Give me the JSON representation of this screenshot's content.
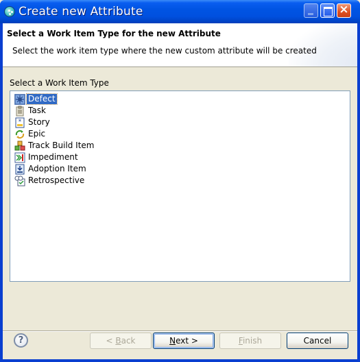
{
  "window": {
    "title": "Create new Attribute",
    "controls": {
      "minimize": "minimize",
      "maximize": "maximize",
      "close": "×"
    }
  },
  "header": {
    "title": "Select a Work Item Type for the new Attribute",
    "description": "Select the work item type where the new custom attribute will be created"
  },
  "list": {
    "label": "Select a Work Item Type",
    "selected_index": 0,
    "items": [
      {
        "label": "Defect",
        "icon": "defect-icon"
      },
      {
        "label": "Task",
        "icon": "task-icon"
      },
      {
        "label": "Story",
        "icon": "story-icon"
      },
      {
        "label": "Epic",
        "icon": "epic-icon"
      },
      {
        "label": "Track Build Item",
        "icon": "track-build-item-icon"
      },
      {
        "label": "Impediment",
        "icon": "impediment-icon"
      },
      {
        "label": "Adoption Item",
        "icon": "adoption-item-icon"
      },
      {
        "label": "Retrospective",
        "icon": "retrospective-icon"
      }
    ]
  },
  "footer": {
    "help": "?",
    "back": {
      "prefix": "< ",
      "mnemonic": "B",
      "rest": "ack",
      "enabled": false
    },
    "next": {
      "mnemonic": "N",
      "rest": "ext >",
      "enabled": true,
      "default": true
    },
    "finish": {
      "mnemonic": "F",
      "rest": "inish",
      "enabled": false
    },
    "cancel": {
      "label": "Cancel",
      "enabled": true
    }
  },
  "colors": {
    "titlebar": "#0054e3",
    "selection": "#316ac5",
    "dialog_bg": "#ece9d8",
    "list_border": "#7f9db9"
  }
}
